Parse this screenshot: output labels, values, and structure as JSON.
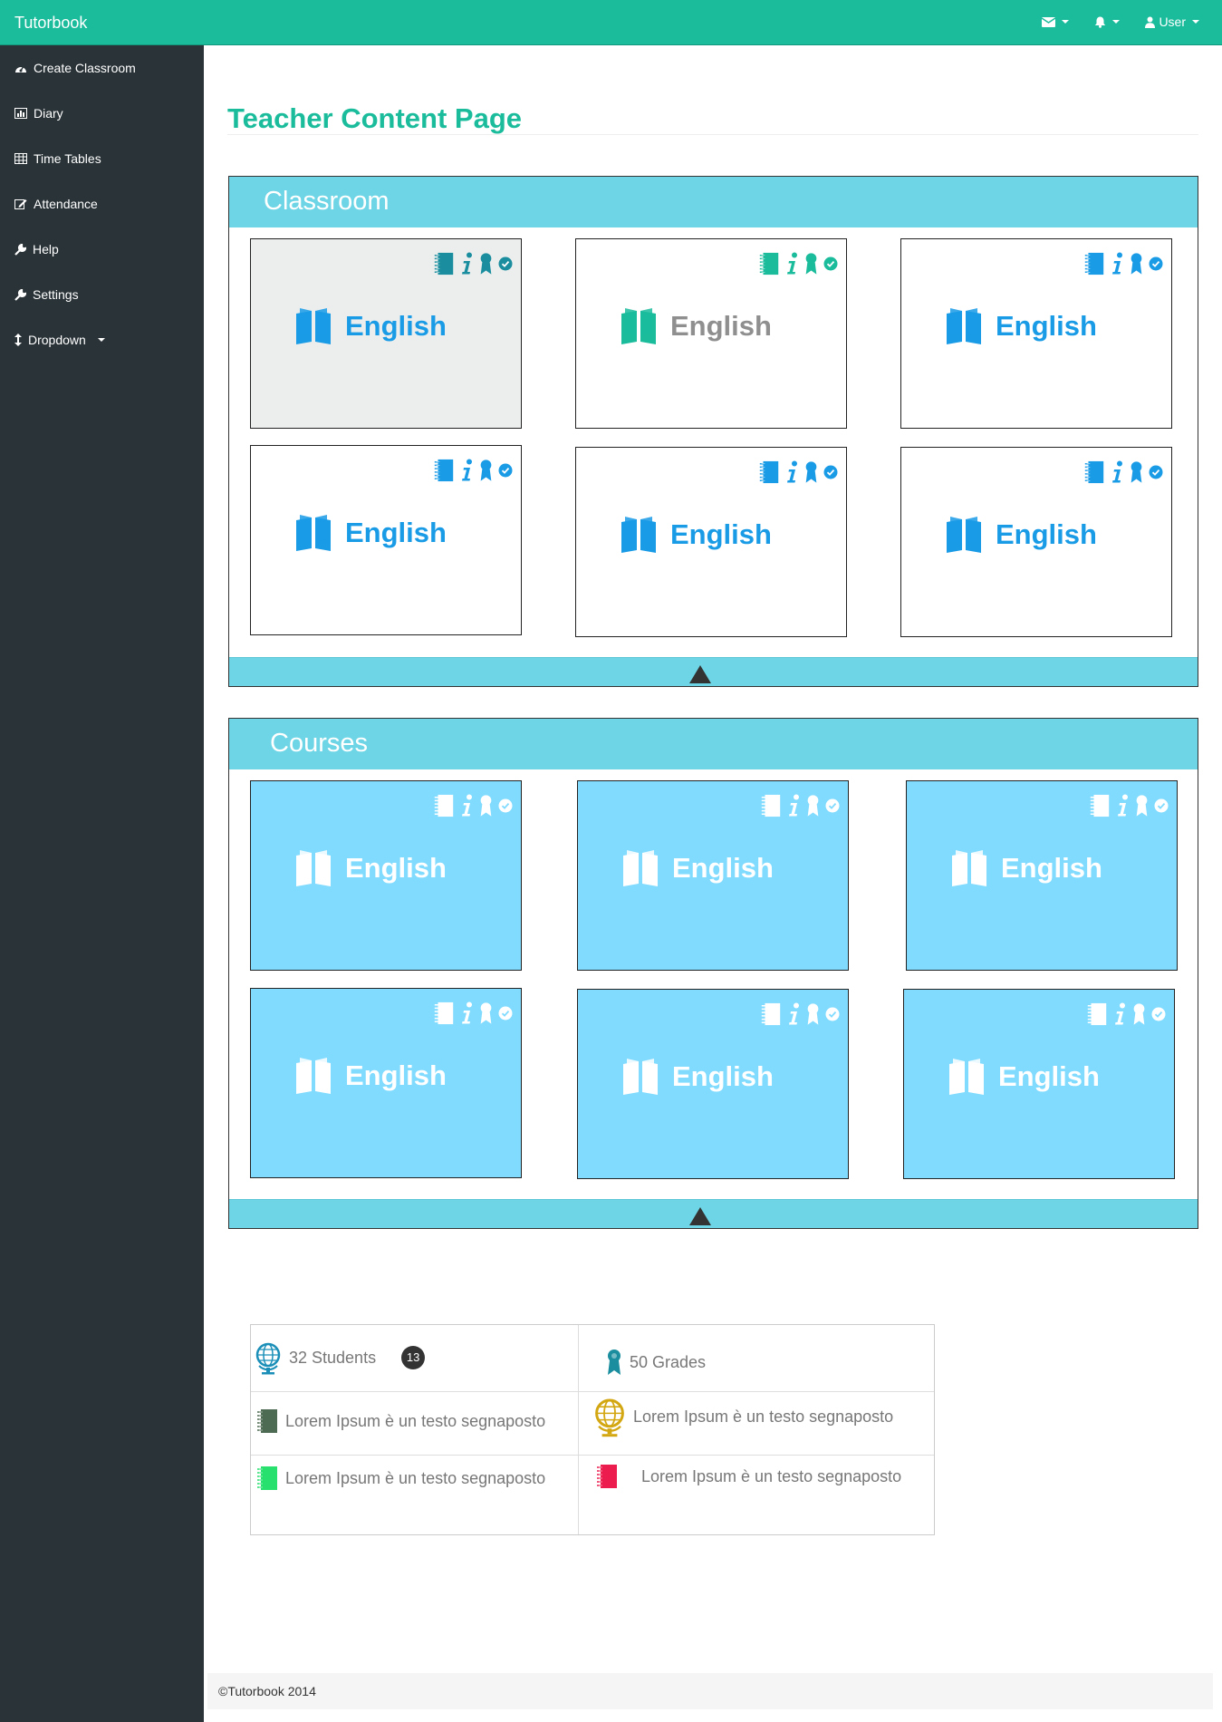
{
  "app": {
    "brand": "Tutorbook"
  },
  "nav": {
    "user_label": "User",
    "colors": {
      "bar": "#1abc9c",
      "sidebar": "#2a3338"
    }
  },
  "sidebar": {
    "items": [
      {
        "label": "Create Classroom",
        "icon": "dashboard-icon"
      },
      {
        "label": "Diary",
        "icon": "bar-chart-icon"
      },
      {
        "label": "Time Tables",
        "icon": "table-icon"
      },
      {
        "label": "Attendance",
        "icon": "edit-icon"
      },
      {
        "label": "Help",
        "icon": "wrench-icon"
      },
      {
        "label": "Settings",
        "icon": "wrench-icon"
      },
      {
        "label": "Dropdown",
        "icon": "resize-vertical-icon"
      }
    ]
  },
  "page": {
    "title": "Teacher Content Page"
  },
  "classroom": {
    "title": "Classroom",
    "cards": [
      {
        "label": "English",
        "state": "selected"
      },
      {
        "label": "English",
        "state": "muted"
      },
      {
        "label": "English",
        "state": "normal"
      },
      {
        "label": "English",
        "state": "normal"
      },
      {
        "label": "English",
        "state": "normal"
      },
      {
        "label": "English",
        "state": "normal"
      }
    ]
  },
  "courses": {
    "title": "Courses",
    "cards": [
      {
        "label": "English"
      },
      {
        "label": "English"
      },
      {
        "label": "English"
      },
      {
        "label": "English"
      },
      {
        "label": "English"
      },
      {
        "label": "English"
      }
    ]
  },
  "stats": {
    "students": "32  Students",
    "students_badge": "13",
    "grades": "50 Grades",
    "lorem_1": "Lorem Ipsum è un testo segnaposto",
    "lorem_2": "Lorem Ipsum è un testo segnaposto",
    "lorem_3": "Lorem Ipsum è un testo segnaposto",
    "lorem_4": "Lorem Ipsum è un testo segnaposto"
  },
  "footer": {
    "text": "©Tutorbook 2014"
  }
}
